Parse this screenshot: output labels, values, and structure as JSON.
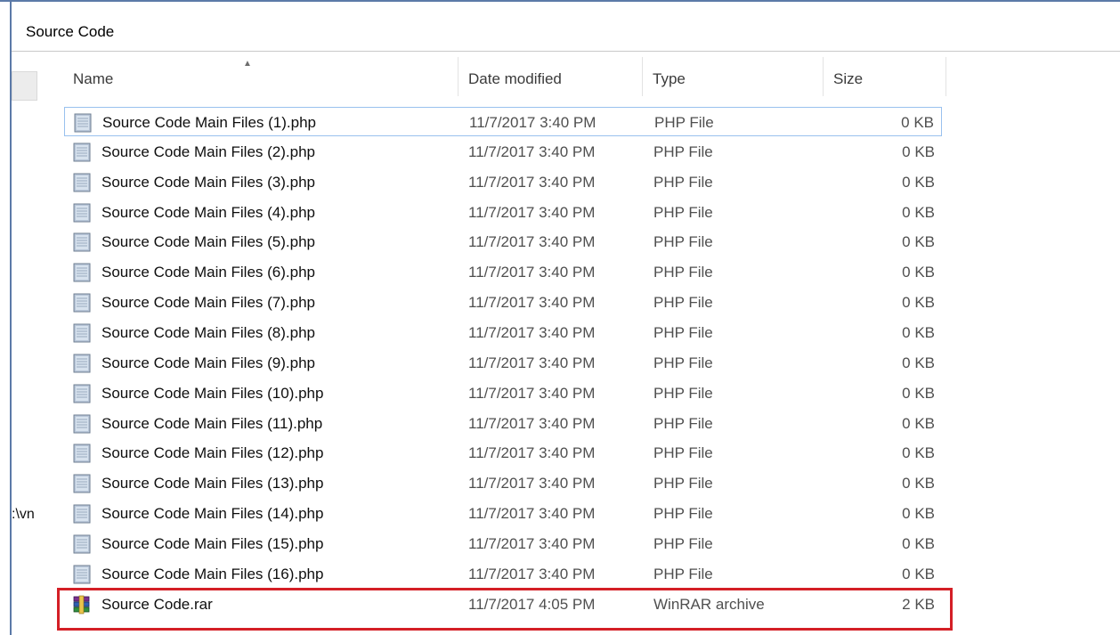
{
  "window": {
    "title": "Source Code"
  },
  "navigation_pane": {
    "path_fragment": ":\\vn"
  },
  "columns": [
    {
      "key": "name",
      "label": "Name",
      "sorted": "ascending"
    },
    {
      "key": "date",
      "label": "Date modified"
    },
    {
      "key": "type",
      "label": "Type"
    },
    {
      "key": "size",
      "label": "Size"
    }
  ],
  "files": [
    {
      "name": "Source Code Main Files (1).php",
      "date": "11/7/2017 3:40 PM",
      "type": "PHP File",
      "size": "0 KB",
      "icon": "php-file-icon",
      "state": "focused"
    },
    {
      "name": "Source Code Main Files (2).php",
      "date": "11/7/2017 3:40 PM",
      "type": "PHP File",
      "size": "0 KB",
      "icon": "php-file-icon"
    },
    {
      "name": "Source Code Main Files (3).php",
      "date": "11/7/2017 3:40 PM",
      "type": "PHP File",
      "size": "0 KB",
      "icon": "php-file-icon"
    },
    {
      "name": "Source Code Main Files (4).php",
      "date": "11/7/2017 3:40 PM",
      "type": "PHP File",
      "size": "0 KB",
      "icon": "php-file-icon"
    },
    {
      "name": "Source Code Main Files (5).php",
      "date": "11/7/2017 3:40 PM",
      "type": "PHP File",
      "size": "0 KB",
      "icon": "php-file-icon"
    },
    {
      "name": "Source Code Main Files (6).php",
      "date": "11/7/2017 3:40 PM",
      "type": "PHP File",
      "size": "0 KB",
      "icon": "php-file-icon"
    },
    {
      "name": "Source Code Main Files (7).php",
      "date": "11/7/2017 3:40 PM",
      "type": "PHP File",
      "size": "0 KB",
      "icon": "php-file-icon"
    },
    {
      "name": "Source Code Main Files (8).php",
      "date": "11/7/2017 3:40 PM",
      "type": "PHP File",
      "size": "0 KB",
      "icon": "php-file-icon"
    },
    {
      "name": "Source Code Main Files (9).php",
      "date": "11/7/2017 3:40 PM",
      "type": "PHP File",
      "size": "0 KB",
      "icon": "php-file-icon"
    },
    {
      "name": "Source Code Main Files (10).php",
      "date": "11/7/2017 3:40 PM",
      "type": "PHP File",
      "size": "0 KB",
      "icon": "php-file-icon"
    },
    {
      "name": "Source Code Main Files (11).php",
      "date": "11/7/2017 3:40 PM",
      "type": "PHP File",
      "size": "0 KB",
      "icon": "php-file-icon"
    },
    {
      "name": "Source Code Main Files (12).php",
      "date": "11/7/2017 3:40 PM",
      "type": "PHP File",
      "size": "0 KB",
      "icon": "php-file-icon"
    },
    {
      "name": "Source Code Main Files (13).php",
      "date": "11/7/2017 3:40 PM",
      "type": "PHP File",
      "size": "0 KB",
      "icon": "php-file-icon"
    },
    {
      "name": "Source Code Main Files (14).php",
      "date": "11/7/2017 3:40 PM",
      "type": "PHP File",
      "size": "0 KB",
      "icon": "php-file-icon"
    },
    {
      "name": "Source Code Main Files (15).php",
      "date": "11/7/2017 3:40 PM",
      "type": "PHP File",
      "size": "0 KB",
      "icon": "php-file-icon"
    },
    {
      "name": "Source Code Main Files (16).php",
      "date": "11/7/2017 3:40 PM",
      "type": "PHP File",
      "size": "0 KB",
      "icon": "php-file-icon"
    },
    {
      "name": "Source Code.rar",
      "date": "11/7/2017 4:05 PM",
      "type": "WinRAR archive",
      "size": "2 KB",
      "icon": "winrar-archive-icon",
      "state": "highlighted"
    }
  ],
  "colors": {
    "window_border": "#5c7aa8",
    "focus_border": "#99c1ee",
    "highlight_annotation": "#d41f26"
  }
}
